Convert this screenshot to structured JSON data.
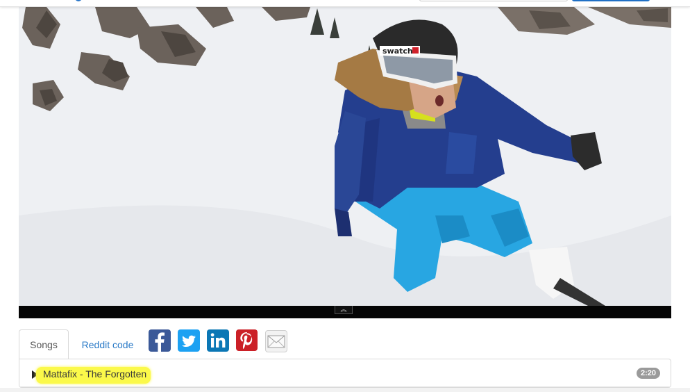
{
  "header": {
    "search_placeholder": "",
    "search_button_label": ""
  },
  "player": {
    "expand_glyph": "︽"
  },
  "tabs": [
    {
      "label": "Songs",
      "active": true
    },
    {
      "label": "Reddit code",
      "active": false
    }
  ],
  "share": [
    {
      "name": "facebook",
      "icon": "facebook-icon"
    },
    {
      "name": "twitter",
      "icon": "twitter-icon"
    },
    {
      "name": "linkedin",
      "icon": "linkedin-icon"
    },
    {
      "name": "pinterest",
      "icon": "pinterest-icon"
    },
    {
      "name": "email",
      "icon": "email-icon"
    }
  ],
  "songs": [
    {
      "title": "Mattafix - The Forgotten",
      "duration": "2:20"
    }
  ],
  "colors": {
    "link": "#2a7ac7",
    "highlight": "#fbf94a",
    "badge": "#9a9a9a",
    "facebook": "#3b5998",
    "twitter": "#1da1f2",
    "linkedin": "#0b77b5",
    "pinterest": "#cb2027"
  }
}
